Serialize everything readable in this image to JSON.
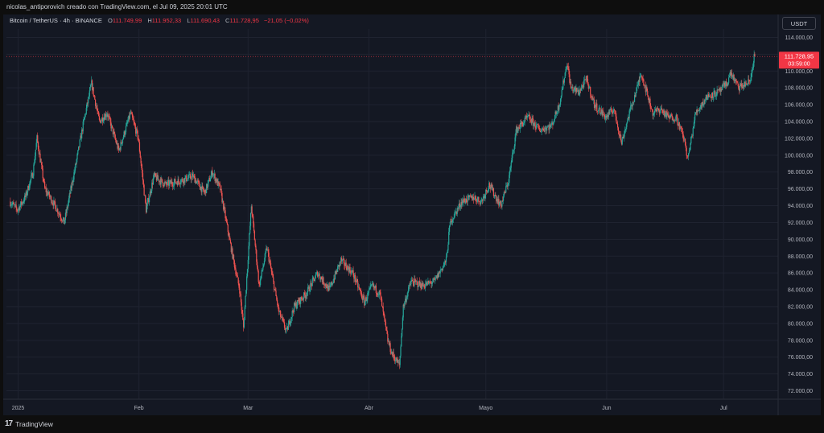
{
  "header": {
    "title": "nicolas_antiporovich creado con TradingView.com, el Jul 09, 2025 20:01 UTC"
  },
  "legend": {
    "symbol": "Bitcoin / TetherUS · 4h · BINANCE",
    "open_label": "O",
    "open": "111.749,99",
    "high_label": "H",
    "high": "111.952,33",
    "low_label": "L",
    "low": "111.690,43",
    "close_label": "C",
    "close": "111.728,95",
    "change": "−21,05 (−0,02%)"
  },
  "currency_button": "USDT",
  "price_badge": {
    "price": "111.728,95",
    "countdown": "03:59:00"
  },
  "footer": {
    "brand": "TradingView"
  },
  "colors": {
    "up": "#26a69a",
    "down": "#ef5350",
    "background": "#141823",
    "grid": "#1f2330",
    "badge": "#f23645"
  },
  "icons": {
    "brand_logo": "tradingview-logo-icon"
  },
  "chart_data": {
    "type": "candlestick",
    "title": "",
    "xlabel": "",
    "ylabel": "",
    "ylim": [
      71000,
      115000
    ],
    "grid": true,
    "y_ticks": [
      {
        "value": 114000,
        "label": "114.000,00"
      },
      {
        "value": 112000,
        "label": "112.000,00"
      },
      {
        "value": 110000,
        "label": "110.000,00"
      },
      {
        "value": 108000,
        "label": "108.000,00"
      },
      {
        "value": 106000,
        "label": "106.000,00"
      },
      {
        "value": 104000,
        "label": "104.000,00"
      },
      {
        "value": 102000,
        "label": "102.000,00"
      },
      {
        "value": 100000,
        "label": "100.000,00"
      },
      {
        "value": 98000,
        "label": "98.000,00"
      },
      {
        "value": 96000,
        "label": "96.000,00"
      },
      {
        "value": 94000,
        "label": "94.000,00"
      },
      {
        "value": 92000,
        "label": "92.000,00"
      },
      {
        "value": 90000,
        "label": "90.000,00"
      },
      {
        "value": 88000,
        "label": "88.000,00"
      },
      {
        "value": 86000,
        "label": "86.000,00"
      },
      {
        "value": 84000,
        "label": "84.000,00"
      },
      {
        "value": 82000,
        "label": "82.000,00"
      },
      {
        "value": 80000,
        "label": "80.000,00"
      },
      {
        "value": 78000,
        "label": "78.000,00"
      },
      {
        "value": 76000,
        "label": "76.000,00"
      },
      {
        "value": 74000,
        "label": "74.000,00"
      },
      {
        "value": 72000,
        "label": "72.000,00"
      }
    ],
    "x_range": [
      "2024-12-29",
      "2025-07-15"
    ],
    "x_ticks": [
      {
        "date": "2025-01-01",
        "label": "2025"
      },
      {
        "date": "2025-02-01",
        "label": "Feb"
      },
      {
        "date": "2025-03-01",
        "label": "Mar"
      },
      {
        "date": "2025-04-01",
        "label": "Abr"
      },
      {
        "date": "2025-05-01",
        "label": "Mayo"
      },
      {
        "date": "2025-06-01",
        "label": "Jun"
      },
      {
        "date": "2025-07-01",
        "label": "Jul"
      }
    ],
    "last_price": 111728.95,
    "series_path": [
      [
        "2024-12-30",
        94500
      ],
      [
        "2025-01-01",
        93500
      ],
      [
        "2025-01-03",
        95000
      ],
      [
        "2025-01-05",
        98000
      ],
      [
        "2025-01-06",
        102000
      ],
      [
        "2025-01-08",
        96000
      ],
      [
        "2025-01-10",
        94500
      ],
      [
        "2025-01-13",
        92000
      ],
      [
        "2025-01-16",
        99000
      ],
      [
        "2025-01-18",
        104000
      ],
      [
        "2025-01-20",
        108500
      ],
      [
        "2025-01-22",
        104000
      ],
      [
        "2025-01-24",
        105000
      ],
      [
        "2025-01-27",
        100500
      ],
      [
        "2025-01-30",
        105000
      ],
      [
        "2025-02-01",
        102000
      ],
      [
        "2025-02-03",
        93500
      ],
      [
        "2025-02-05",
        97500
      ],
      [
        "2025-02-08",
        96500
      ],
      [
        "2025-02-12",
        97000
      ],
      [
        "2025-02-15",
        97500
      ],
      [
        "2025-02-18",
        95500
      ],
      [
        "2025-02-20",
        98000
      ],
      [
        "2025-02-22",
        96000
      ],
      [
        "2025-02-25",
        88500
      ],
      [
        "2025-02-27",
        84000
      ],
      [
        "2025-02-28",
        79500
      ],
      [
        "2025-03-02",
        94000
      ],
      [
        "2025-03-04",
        84500
      ],
      [
        "2025-03-06",
        89000
      ],
      [
        "2025-03-09",
        81500
      ],
      [
        "2025-03-11",
        79000
      ],
      [
        "2025-03-13",
        82000
      ],
      [
        "2025-03-16",
        83500
      ],
      [
        "2025-03-19",
        86000
      ],
      [
        "2025-03-22",
        84000
      ],
      [
        "2025-03-25",
        87500
      ],
      [
        "2025-03-28",
        86000
      ],
      [
        "2025-03-31",
        82500
      ],
      [
        "2025-04-02",
        84500
      ],
      [
        "2025-04-04",
        83500
      ],
      [
        "2025-04-06",
        78000
      ],
      [
        "2025-04-07",
        76500
      ],
      [
        "2025-04-09",
        75000
      ],
      [
        "2025-04-10",
        82000
      ],
      [
        "2025-04-12",
        85000
      ],
      [
        "2025-04-15",
        84500
      ],
      [
        "2025-04-18",
        85000
      ],
      [
        "2025-04-21",
        87500
      ],
      [
        "2025-04-22",
        92000
      ],
      [
        "2025-04-25",
        94500
      ],
      [
        "2025-04-28",
        95000
      ],
      [
        "2025-04-30",
        94500
      ],
      [
        "2025-05-02",
        96500
      ],
      [
        "2025-05-05",
        94000
      ],
      [
        "2025-05-07",
        97000
      ],
      [
        "2025-05-08",
        100000
      ],
      [
        "2025-05-09",
        103000
      ],
      [
        "2025-05-12",
        104500
      ],
      [
        "2025-05-15",
        103000
      ],
      [
        "2025-05-18",
        103500
      ],
      [
        "2025-05-20",
        106000
      ],
      [
        "2025-05-22",
        111000
      ],
      [
        "2025-05-23",
        108000
      ],
      [
        "2025-05-25",
        107500
      ],
      [
        "2025-05-27",
        109000
      ],
      [
        "2025-05-29",
        106000
      ],
      [
        "2025-06-01",
        104500
      ],
      [
        "2025-06-03",
        105500
      ],
      [
        "2025-06-05",
        101500
      ],
      [
        "2025-06-07",
        105000
      ],
      [
        "2025-06-09",
        108000
      ],
      [
        "2025-06-10",
        109800
      ],
      [
        "2025-06-13",
        105000
      ],
      [
        "2025-06-15",
        105500
      ],
      [
        "2025-06-17",
        104500
      ],
      [
        "2025-06-19",
        104500
      ],
      [
        "2025-06-21",
        102000
      ],
      [
        "2025-06-22",
        99500
      ],
      [
        "2025-06-24",
        105000
      ],
      [
        "2025-06-27",
        107000
      ],
      [
        "2025-06-30",
        107500
      ],
      [
        "2025-07-02",
        108500
      ],
      [
        "2025-07-03",
        109800
      ],
      [
        "2025-07-05",
        108000
      ],
      [
        "2025-07-07",
        108500
      ],
      [
        "2025-07-08",
        108800
      ],
      [
        "2025-07-09",
        111728.95
      ]
    ]
  }
}
